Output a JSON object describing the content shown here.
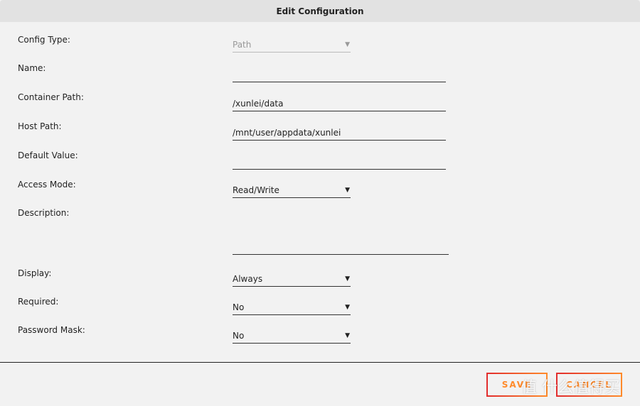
{
  "header": {
    "title": "Edit Configuration"
  },
  "form": {
    "config_type": {
      "label": "Config Type:",
      "value": "Path"
    },
    "name": {
      "label": "Name:",
      "value": ""
    },
    "container_path": {
      "label": "Container Path:",
      "value": "/xunlei/data"
    },
    "host_path": {
      "label": "Host Path:",
      "value": "/mnt/user/appdata/xunlei"
    },
    "default_value": {
      "label": "Default Value:",
      "value": ""
    },
    "access_mode": {
      "label": "Access Mode:",
      "value": "Read/Write"
    },
    "description": {
      "label": "Description:",
      "value": ""
    },
    "display": {
      "label": "Display:",
      "value": "Always"
    },
    "required": {
      "label": "Required:",
      "value": "No"
    },
    "password_mask": {
      "label": "Password Mask:",
      "value": "No"
    }
  },
  "buttons": {
    "save": "SAVE",
    "cancel": "CANCEL"
  },
  "watermark": "值 什么值得买",
  "colors": {
    "button_gradient_start": "#e22d2d",
    "button_gradient_end": "#ff8a2a"
  }
}
